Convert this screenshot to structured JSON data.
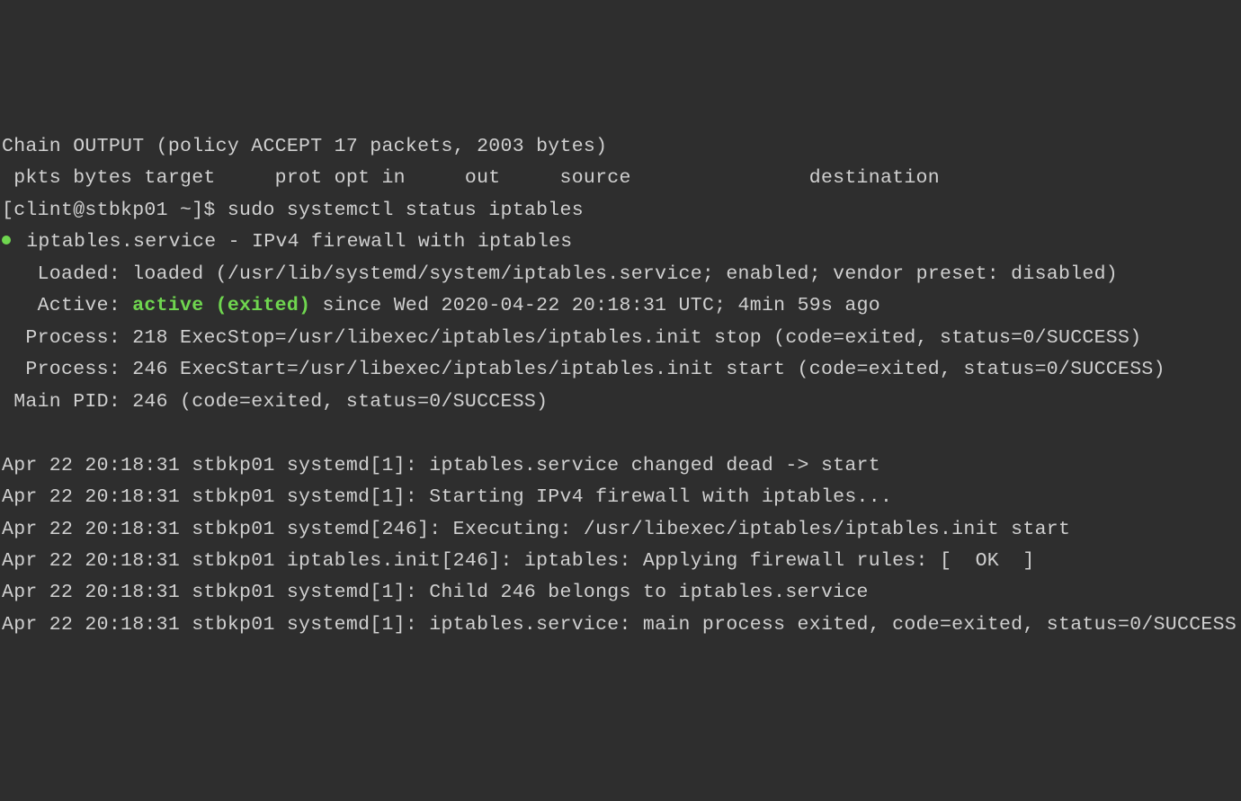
{
  "terminal": {
    "line1": "Chain OUTPUT (policy ACCEPT 17 packets, 2003 bytes)",
    "line2": " pkts bytes target     prot opt in     out     source               destination",
    "prompt": "[clint@stbkp01 ~]$ ",
    "command": "sudo systemctl status iptables",
    "service_line": " iptables.service - IPv4 firewall with iptables",
    "loaded_line": "   Loaded: loaded (/usr/lib/systemd/system/iptables.service; enabled; vendor preset: disabled)",
    "active_prefix": "   Active: ",
    "active_status": "active (exited)",
    "active_suffix": " since Wed 2020-04-22 20:18:31 UTC; 4min 59s ago",
    "process1": "  Process: 218 ExecStop=/usr/libexec/iptables/iptables.init stop (code=exited, status=0/SUCCESS)",
    "process2": "  Process: 246 ExecStart=/usr/libexec/iptables/iptables.init start (code=exited, status=0/SUCCESS)",
    "mainpid": " Main PID: 246 (code=exited, status=0/SUCCESS)",
    "blank": "",
    "log1": "Apr 22 20:18:31 stbkp01 systemd[1]: iptables.service changed dead -> start",
    "log2": "Apr 22 20:18:31 stbkp01 systemd[1]: Starting IPv4 firewall with iptables...",
    "log3": "Apr 22 20:18:31 stbkp01 systemd[246]: Executing: /usr/libexec/iptables/iptables.init start",
    "log4": "Apr 22 20:18:31 stbkp01 iptables.init[246]: iptables: Applying firewall rules: [  OK  ]",
    "log5": "Apr 22 20:18:31 stbkp01 systemd[1]: Child 246 belongs to iptables.service",
    "log6": "Apr 22 20:18:31 stbkp01 systemd[1]: iptables.service: main process exited, code=exited, status=0/SUCCESS"
  }
}
